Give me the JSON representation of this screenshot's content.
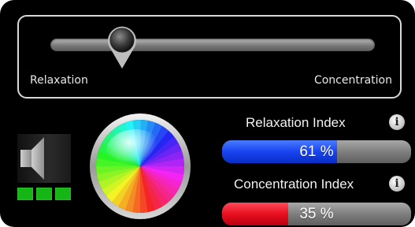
{
  "slider": {
    "left_label": "Relaxation",
    "right_label": "Concentration",
    "position": 0.22
  },
  "volume": {
    "icon": "speaker-icon",
    "level_bars": 3,
    "bar_color": "#14b514"
  },
  "color_wheel": {
    "icon": "color-wheel-icon"
  },
  "relaxation": {
    "title": "Relaxation Index",
    "value_text": "61 %",
    "value": 0.61,
    "color": "#1843f0"
  },
  "concentration": {
    "title": "Concentration Index",
    "value_text": "35 %",
    "value": 0.35,
    "color": "#e8101f"
  },
  "info_icon_label": "i"
}
